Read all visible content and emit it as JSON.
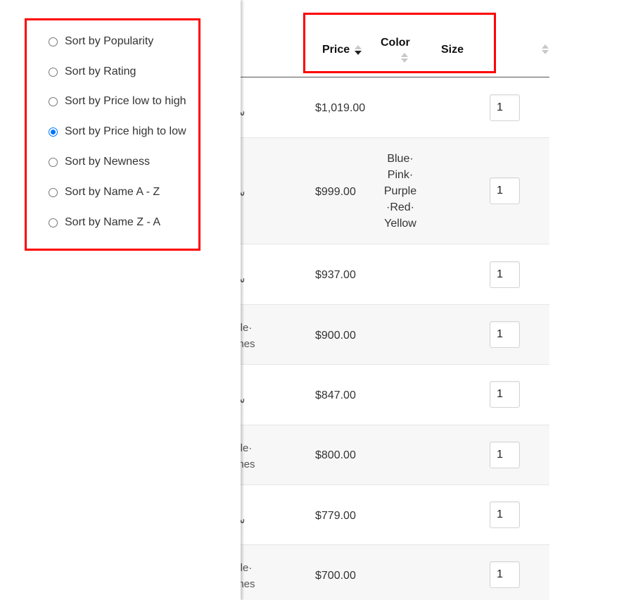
{
  "sort_options": [
    {
      "label": "Sort by Popularity",
      "checked": false
    },
    {
      "label": "Sort by Rating",
      "checked": false
    },
    {
      "label": "Sort by Price low to high",
      "checked": false
    },
    {
      "label": "Sort by Price high to low",
      "checked": true
    },
    {
      "label": "Sort by Newness",
      "checked": false
    },
    {
      "label": "Sort by Name A - Z",
      "checked": false
    },
    {
      "label": "Sort by Name Z - A",
      "checked": false
    }
  ],
  "table": {
    "headers": {
      "price": "Price",
      "color": "Color",
      "size": "Size"
    },
    "price_sort_direction": "descending",
    "rows": [
      {
        "product_fragment": "س",
        "price": "$1,019.00",
        "color": "",
        "quantity": "1"
      },
      {
        "product_fragment": "س",
        "price": "$999.00",
        "color": "Blue· Pink· Purple ·Red· Yellow",
        "quantity": "1"
      },
      {
        "product_fragment": "س",
        "price": "$937.00",
        "color": "",
        "quantity": "1"
      },
      {
        "product_fragment": "bile· ones",
        "price": "$900.00",
        "color": "",
        "quantity": "1"
      },
      {
        "product_fragment": "س",
        "price": "$847.00",
        "color": "",
        "quantity": "1"
      },
      {
        "product_fragment": "bile· ones",
        "price": "$800.00",
        "color": "",
        "quantity": "1"
      },
      {
        "product_fragment": "س",
        "price": "$779.00",
        "color": "",
        "quantity": "1"
      },
      {
        "product_fragment": "bile· ones",
        "price": "$700.00",
        "color": "",
        "quantity": "1"
      }
    ]
  },
  "colors": {
    "highlight": "#ff0000",
    "radio_accent": "#0075ff",
    "alt_row_bg": "#f7f7f7"
  }
}
